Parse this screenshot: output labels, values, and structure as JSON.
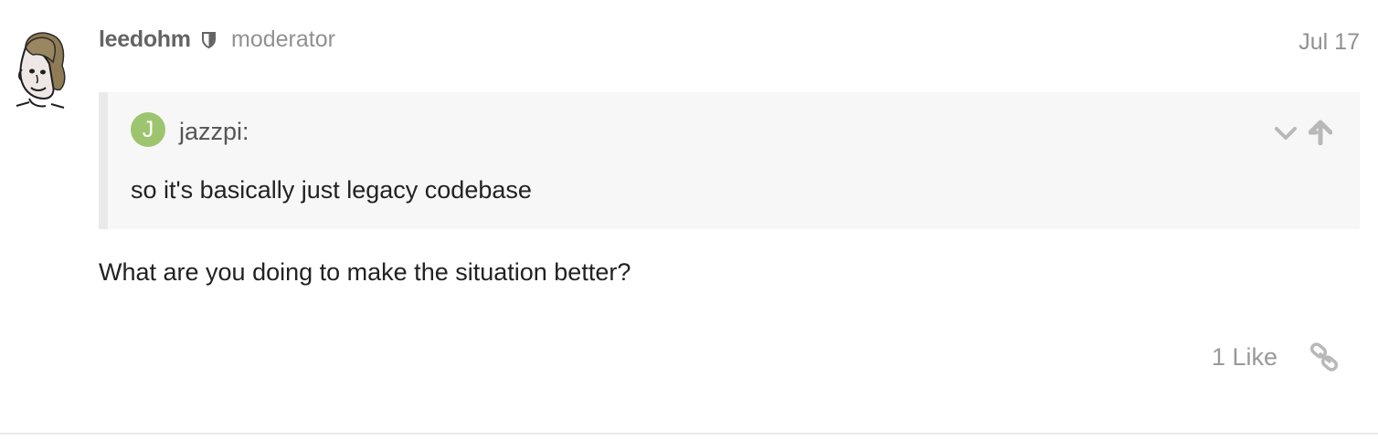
{
  "post": {
    "author": {
      "username": "leedohm",
      "title": "moderator",
      "avatar_icon": "cartoon-avatar",
      "badge_icon": "moderator-shield-icon"
    },
    "date": "Jul 17",
    "quote": {
      "author_initial": "J",
      "author_label": "jazzpi:",
      "avatar_color": "#9dc56f",
      "text": "so it's basically just legacy codebase",
      "expand_icon": "chevron-down-icon",
      "jump_icon": "arrow-up-icon"
    },
    "body": "What are you doing to make the situation better?",
    "actions": {
      "like_label": "1 Like",
      "link_icon": "link-icon"
    }
  },
  "colors": {
    "username": "#646464",
    "muted": "#919191",
    "quote_background": "#f7f7f7",
    "quote_border": "#e9e9e9",
    "body_text": "#222222"
  }
}
